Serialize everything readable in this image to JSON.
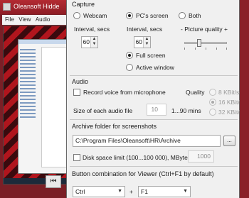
{
  "background_app": {
    "title": "Oleansoft Hidde",
    "menu": [
      "File",
      "View",
      "Audio"
    ],
    "nav_icon": "skip-back-icon"
  },
  "capture": {
    "title": "Capture",
    "webcam_label": "Webcam",
    "pcscreen_label": "PC's screen",
    "both_label": "Both",
    "selected_source": "PC's screen",
    "webcam_interval_label": "Interval, secs",
    "webcam_interval_value": "60",
    "pc_interval_label": "Interval, secs",
    "pc_interval_value": "60",
    "quality_label": "- Picture quality +",
    "quality_level": 0.35,
    "fullscreen_label": "Full screen",
    "activewindow_label": "Active window",
    "selected_mode": "Full screen"
  },
  "audio": {
    "title": "Audio",
    "record_label": "Record voice from microphone",
    "record_checked": false,
    "quality_label": "Quality",
    "q8_label": "8 KBit/sec",
    "q16_label": "16 KBit/sec",
    "q32_label": "32 KBit/sec",
    "selected_quality": "16 KBit/sec",
    "size_label": "Size of each audio file",
    "size_value": "10",
    "size_range": "1...90 mins"
  },
  "archive": {
    "title": "Archive folder for screenshots",
    "path": "C:\\Program Files\\Oleansoft\\HR\\Archive",
    "browse_label": "...",
    "disk_limit_label": "Disk space limit (100...100 000), MBytes",
    "disk_limit_checked": false,
    "disk_limit_value": "1000"
  },
  "hotkey": {
    "title": "Button combination for Viewer (Ctrl+F1 by default)",
    "modifier": "Ctrl",
    "plus": "+",
    "key": "F1"
  },
  "colors": {
    "accent_red": "#8e1e26",
    "dialog_bg": "#f0f0f0"
  }
}
